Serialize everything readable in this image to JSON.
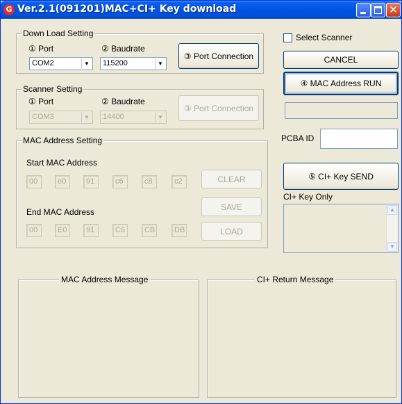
{
  "window": {
    "title": "Ver.2.1(091201)MAC+CI+ Key download",
    "icon": "app-logo-icon"
  },
  "download": {
    "title": "Down Load Setting",
    "port_label": "① Port",
    "baud_label": "② Baudrate",
    "port_value": "COM2",
    "baud_value": "115200",
    "connect_label": "③ Port Connection"
  },
  "scanner": {
    "title": "Scanner Setting",
    "port_label": "① Port",
    "baud_label": "② Baudrate",
    "port_value": "COM3",
    "baud_value": "14400",
    "connect_label": "③ Port Connection"
  },
  "mac": {
    "title": "MAC Address Setting",
    "start_label": "Start MAC Address",
    "end_label": "End MAC Address",
    "start": [
      "00",
      "e0",
      "91",
      "c6",
      "c8",
      "c2"
    ],
    "end": [
      "00",
      "E0",
      "91",
      "C6",
      "CB",
      "DB"
    ],
    "clear_label": "CLEAR",
    "save_label": "SAVE",
    "load_label": "LOAD"
  },
  "right": {
    "select_scanner_label": "Select Scanner",
    "cancel_label": "CANCEL",
    "mac_run_label": "④ MAC Address RUN",
    "pcba_label": "PCBA ID",
    "ci_send_label": "⑤ CI+ Key SEND",
    "ci_only_label": "CI+ Key Only"
  },
  "messages": {
    "mac_title": "MAC Address Message",
    "ci_title": "CI+ Return Message"
  },
  "colors": {
    "titlebar": "#0054e3",
    "window_bg": "#ece9d8",
    "disabled_text": "#aca899"
  }
}
